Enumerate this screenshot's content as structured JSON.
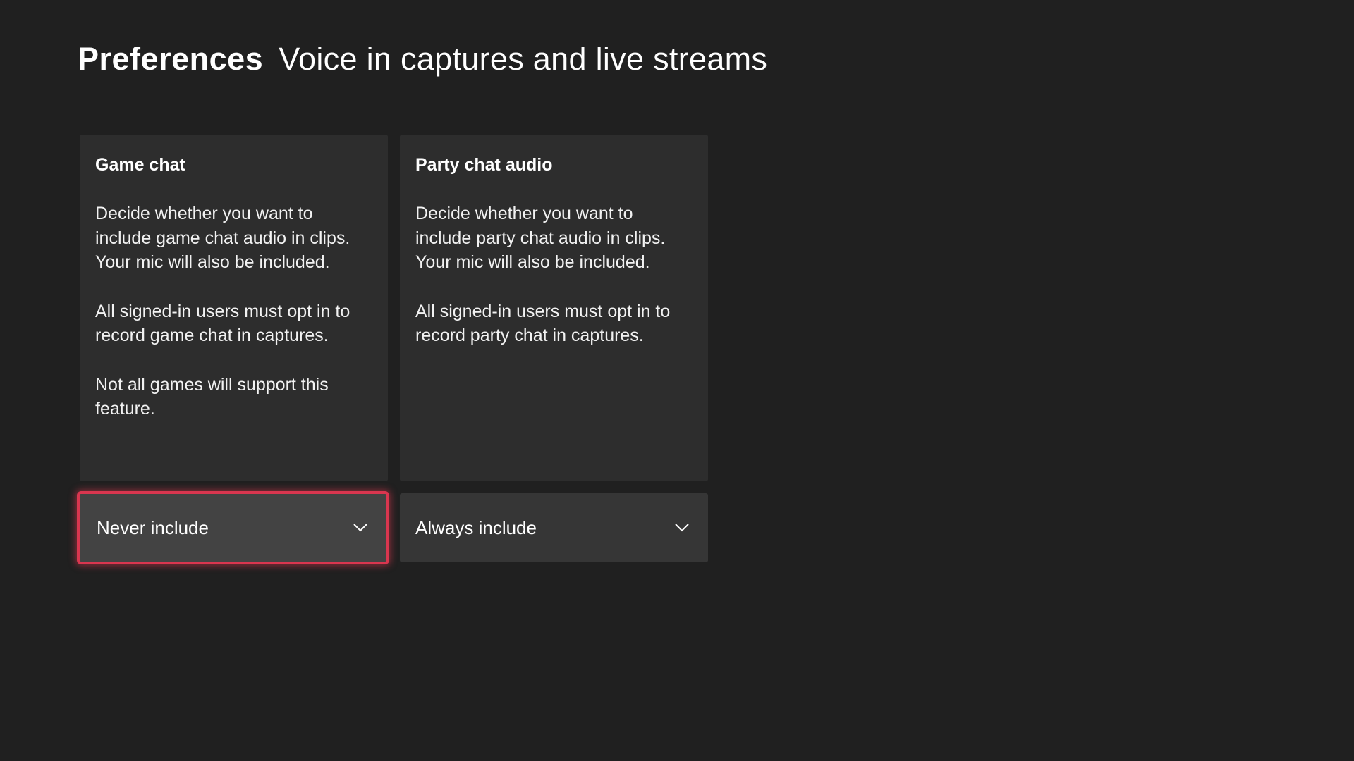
{
  "header": {
    "section": "Preferences",
    "title": "Voice in captures and live streams"
  },
  "cards": {
    "game_chat": {
      "title": "Game chat",
      "paragraphs": [
        "Decide whether you want to include game chat audio in clips. Your mic will also be included.",
        "All signed-in users must opt in to record game chat in captures.",
        "Not all games will support this feature."
      ],
      "dropdown_value": "Never include",
      "dropdown_icon": "chevron-down-icon",
      "focused": true
    },
    "party_chat": {
      "title": "Party chat audio",
      "paragraphs": [
        "Decide whether you want to include party chat audio in clips. Your mic will also be included.",
        "All signed-in users must opt in to record party chat in captures."
      ],
      "dropdown_value": "Always include",
      "dropdown_icon": "chevron-down-icon",
      "focused": false
    }
  },
  "colors": {
    "background": "#202020",
    "card": "#2d2d2d",
    "dropdown": "#363636",
    "focus_ring": "#d9364f"
  }
}
